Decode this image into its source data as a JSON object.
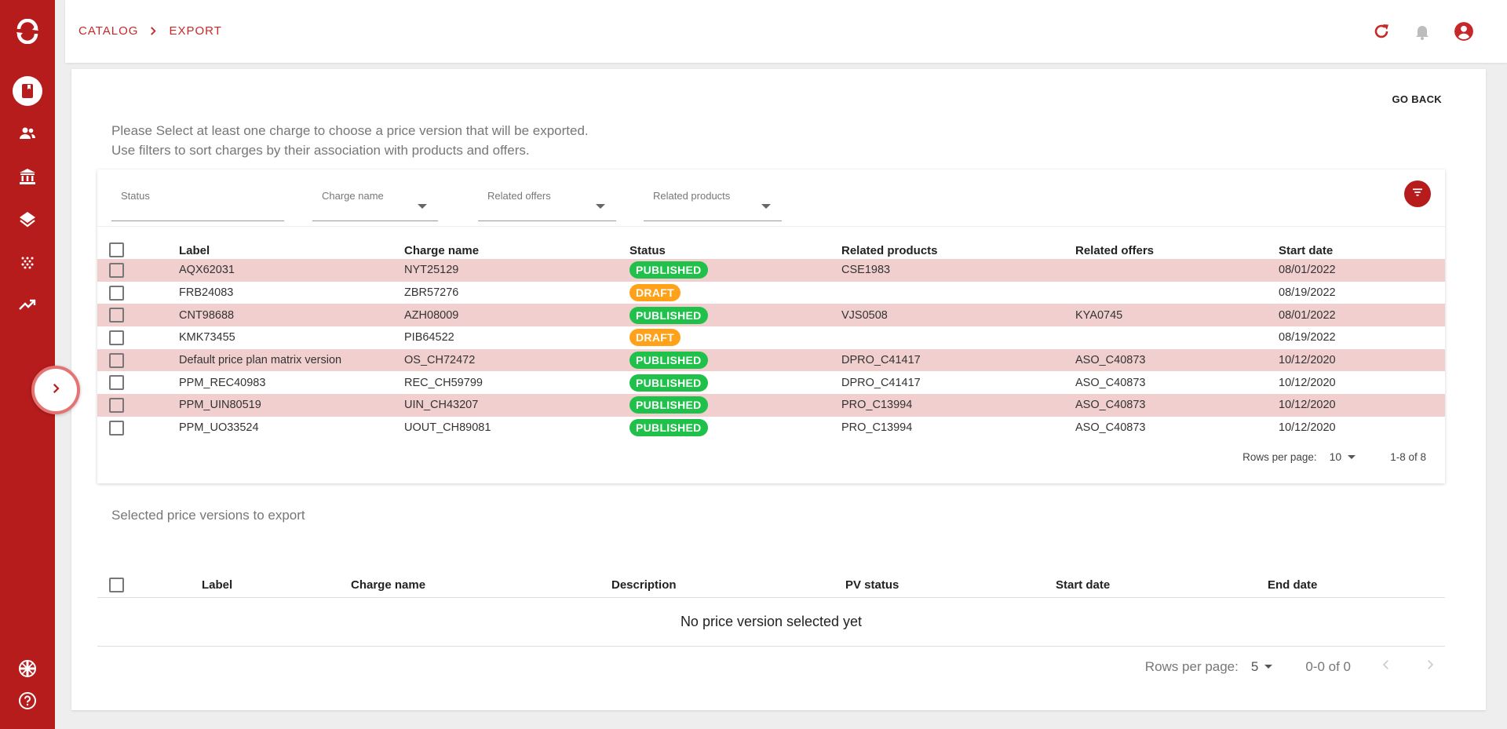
{
  "colors": {
    "brand": "#b71c1c",
    "published": "#1fc14a",
    "draft": "#ffa21a",
    "row_highlight": "#f1cfcf"
  },
  "sidebar": {
    "items": [
      {
        "icon": "catalog-book-icon",
        "active": true
      },
      {
        "icon": "users-icon"
      },
      {
        "icon": "bank-icon"
      },
      {
        "icon": "layers-icon"
      },
      {
        "icon": "dots-pattern-icon"
      },
      {
        "icon": "trending-up-icon"
      }
    ],
    "bottom": [
      {
        "icon": "uk-flag-icon"
      },
      {
        "icon": "help-icon"
      }
    ]
  },
  "header": {
    "breadcrumb": [
      "CATALOG",
      "EXPORT"
    ],
    "icons": [
      "refresh-icon",
      "notifications-bell-icon",
      "account-icon"
    ]
  },
  "page": {
    "go_back": "GO BACK",
    "intro_line1": "Please Select at least one charge to choose a price version that will be exported.",
    "intro_line2": "Use filters to sort charges by their association with products and offers."
  },
  "filters": {
    "status": "Status",
    "charge_name": "Charge name",
    "related_offers": "Related offers",
    "related_products": "Related products"
  },
  "charges_table": {
    "columns": [
      "Label",
      "Charge name",
      "Status",
      "Related products",
      "Related offers",
      "Start date"
    ],
    "rows": [
      {
        "label": "AQX62031",
        "charge": "NYT25129",
        "status": "PUBLISHED",
        "products": "CSE1983",
        "offers": "",
        "start": "08/01/2022"
      },
      {
        "label": "FRB24083",
        "charge": "ZBR57276",
        "status": "DRAFT",
        "products": "",
        "offers": "",
        "start": "08/19/2022"
      },
      {
        "label": "CNT98688",
        "charge": "AZH08009",
        "status": "PUBLISHED",
        "products": "VJS0508",
        "offers": "KYA0745",
        "start": "08/01/2022"
      },
      {
        "label": "KMK73455",
        "charge": "PIB64522",
        "status": "DRAFT",
        "products": "",
        "offers": "",
        "start": "08/19/2022"
      },
      {
        "label": "Default price plan matrix version",
        "charge": "OS_CH72472",
        "status": "PUBLISHED",
        "products": "DPRO_C41417",
        "offers": "ASO_C40873",
        "start": "10/12/2020"
      },
      {
        "label": "PPM_REC40983",
        "charge": "REC_CH59799",
        "status": "PUBLISHED",
        "products": "DPRO_C41417",
        "offers": "ASO_C40873",
        "start": "10/12/2020"
      },
      {
        "label": "PPM_UIN80519",
        "charge": "UIN_CH43207",
        "status": "PUBLISHED",
        "products": "PRO_C13994",
        "offers": "ASO_C40873",
        "start": "10/12/2020"
      },
      {
        "label": "PPM_UO33524",
        "charge": "UOUT_CH89081",
        "status": "PUBLISHED",
        "products": "PRO_C13994",
        "offers": "ASO_C40873",
        "start": "10/12/2020"
      }
    ],
    "pagination": {
      "rows_per_page_label": "Rows per page:",
      "rows_per_page": "10",
      "range": "1-8 of 8"
    }
  },
  "selected_table": {
    "title": "Selected price versions to export",
    "columns": [
      "Label",
      "Charge name",
      "Description",
      "PV status",
      "Start date",
      "End date"
    ],
    "empty_message": "No price version selected yet",
    "pagination": {
      "rows_per_page_label": "Rows per page:",
      "rows_per_page": "5",
      "range": "0-0 of 0"
    }
  }
}
